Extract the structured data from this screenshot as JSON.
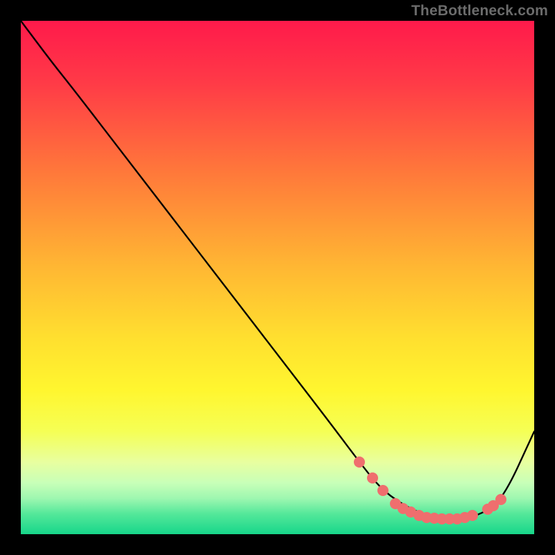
{
  "attribution": "TheBottleneck.com",
  "colors": {
    "dot": "#ef6e6e",
    "curve": "#000000"
  },
  "chart_data": {
    "type": "line",
    "title": "",
    "xlabel": "",
    "ylabel": "",
    "xlim": [
      0,
      100
    ],
    "ylim": [
      0,
      100
    ],
    "x": [
      0,
      6,
      10,
      20,
      30,
      40,
      50,
      60,
      66,
      70,
      74,
      78,
      82,
      86,
      90,
      94,
      100
    ],
    "values": [
      100,
      92,
      87,
      74,
      61,
      48,
      35,
      22,
      14,
      9,
      6,
      4,
      3,
      3,
      4,
      7,
      20
    ],
    "dot_points": [
      {
        "x": 66.0,
        "y": 14.0
      },
      {
        "x": 68.5,
        "y": 11.0
      },
      {
        "x": 70.5,
        "y": 8.5
      },
      {
        "x": 73.0,
        "y": 6.0
      },
      {
        "x": 74.5,
        "y": 5.0
      },
      {
        "x": 76.0,
        "y": 4.3
      },
      {
        "x": 77.5,
        "y": 3.7
      },
      {
        "x": 79.0,
        "y": 3.3
      },
      {
        "x": 80.5,
        "y": 3.1
      },
      {
        "x": 82.0,
        "y": 3.0
      },
      {
        "x": 83.5,
        "y": 3.0
      },
      {
        "x": 85.0,
        "y": 3.0
      },
      {
        "x": 86.5,
        "y": 3.2
      },
      {
        "x": 88.0,
        "y": 3.6
      },
      {
        "x": 91.0,
        "y": 4.8
      },
      {
        "x": 92.0,
        "y": 5.6
      },
      {
        "x": 93.5,
        "y": 6.8
      }
    ]
  }
}
